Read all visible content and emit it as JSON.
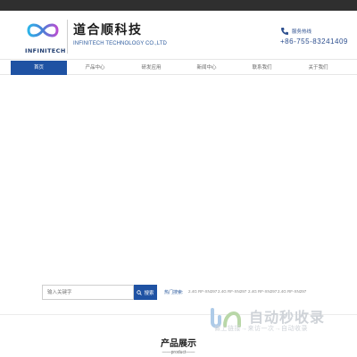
{
  "header": {
    "logo_word": "INFINITECH",
    "company_cn": "道合顺科技",
    "company_en": "INFINITECH TECHNOLOGY CO.,LTD",
    "hotline_label": "服务热线",
    "hotline_number": "+86-755-83241409",
    "logo_icon": "infinity-logo",
    "phone_icon": "phone-icon"
  },
  "nav": {
    "items": [
      {
        "label": "首页",
        "active": true
      },
      {
        "label": "产品中心",
        "active": false
      },
      {
        "label": "研发应用",
        "active": false
      },
      {
        "label": "新闻中心",
        "active": false
      },
      {
        "label": "联系我们",
        "active": false
      },
      {
        "label": "关于我们",
        "active": false
      }
    ]
  },
  "search": {
    "placeholder": "输入关键字",
    "button_label": "搜索",
    "hot_label": "热门搜索:",
    "hot_tags": [
      "2.4G RF-XN297",
      "2.4G RF-XN297",
      "2.4G RF-XN297",
      "2.4G RF-XN297"
    ]
  },
  "section": {
    "title": "产品展示",
    "subtitle": "——product——"
  },
  "watermark": {
    "title": "自动秒收录",
    "subtitle": "做上链接→来访一次→自动收录"
  },
  "colors": {
    "primary": "#1f52a3",
    "topbar": "#2f2f2f",
    "accent_text": "#2f5d9f"
  }
}
